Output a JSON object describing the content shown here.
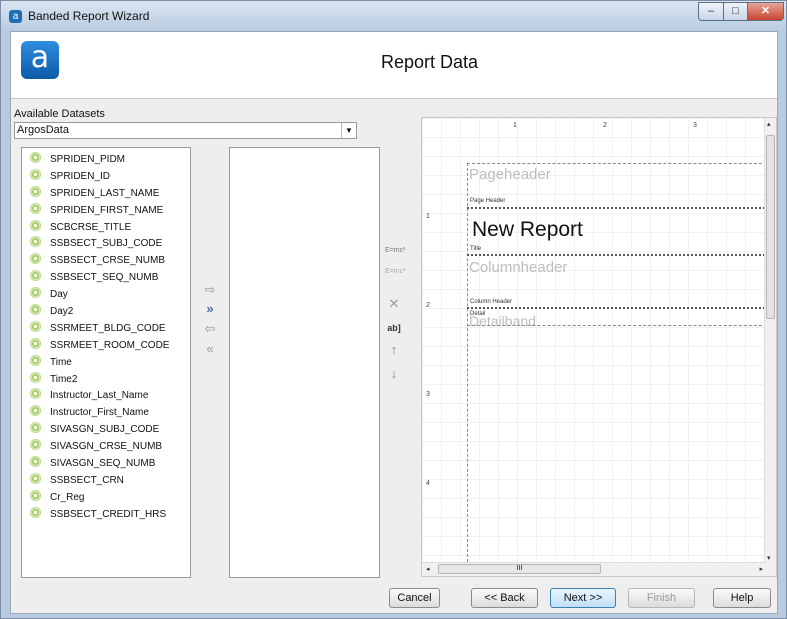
{
  "window": {
    "title": "Banded Report Wizard",
    "icon_letter": "a",
    "min": "–",
    "max": "□",
    "close": "✕"
  },
  "header": {
    "logo_letter": "a",
    "page_title": "Report Data"
  },
  "datasets": {
    "label": "Available Datasets",
    "selected": "ArgosData",
    "arrow": "▼"
  },
  "available_fields": [
    "SPRIDEN_PIDM",
    "SPRIDEN_ID",
    "SPRIDEN_LAST_NAME",
    "SPRIDEN_FIRST_NAME",
    "SCBCRSE_TITLE",
    "SSBSECT_SUBJ_CODE",
    "SSBSECT_CRSE_NUMB",
    "SSBSECT_SEQ_NUMB",
    "Day",
    "Day2",
    "SSRMEET_BLDG_CODE",
    "SSRMEET_ROOM_CODE",
    "Time",
    "Time2",
    "Instructor_Last_Name",
    "Instructor_First_Name",
    "SIVASGN_SUBJ_CODE",
    "SIVASGN_CRSE_NUMB",
    "SIVASGN_SEQ_NUMB",
    "SSBSECT_CRN",
    "Cr_Reg",
    "SSBSECT_CREDIT_HRS"
  ],
  "movers": {
    "add": "⇨",
    "add_all": "»",
    "remove": "⇦",
    "remove_all": "«"
  },
  "tools": {
    "t1": "E=mc²",
    "t2": "E=mc²",
    "delete": "✕",
    "rename": "ab]",
    "up": "↑",
    "down": "↓"
  },
  "designer": {
    "ruler_top": [
      "1",
      "2",
      "3"
    ],
    "ruler_left": [
      "1",
      "2",
      "3",
      "4"
    ],
    "pageheader_ghost": "Pageheader",
    "page_header_label": "Page Header",
    "report_title": "New Report",
    "title_label": "Title",
    "columnheader_ghost": "Columnheader",
    "column_header_label": "Column Header",
    "detail_label": "Detail",
    "detailband_ghost": "Detailband",
    "hscroll_grip": "III",
    "arrow_left": "◂",
    "arrow_right": "▸",
    "arrow_up": "▴",
    "arrow_down": "▾"
  },
  "buttons": {
    "cancel": "Cancel",
    "back": "<< Back",
    "next": "Next >>",
    "finish": "Finish",
    "help": "Help"
  }
}
